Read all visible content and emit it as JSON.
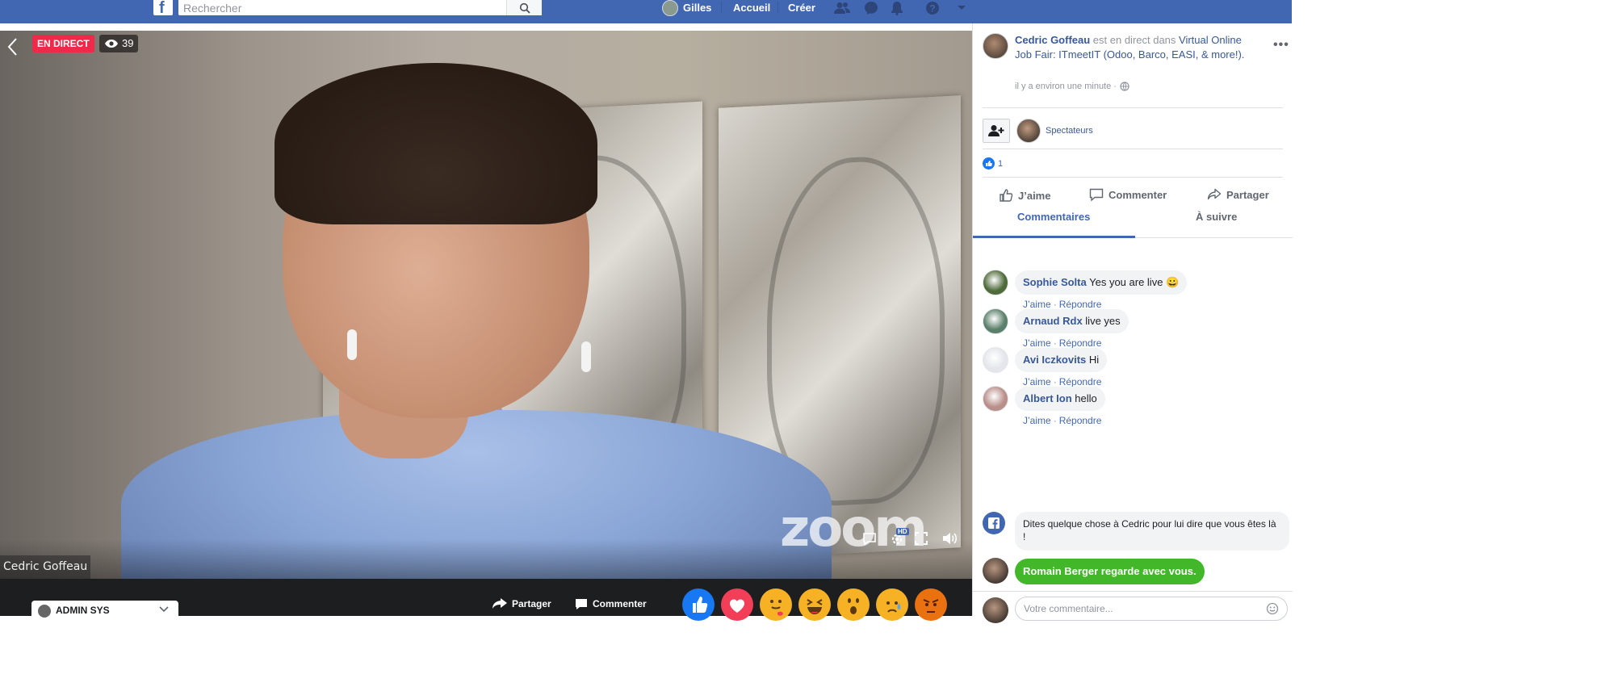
{
  "topbar": {
    "logo_letter": "f",
    "search_placeholder": "Rechercher",
    "user_name": "Gilles",
    "nav_home": "Accueil",
    "nav_create": "Créer"
  },
  "video": {
    "live_badge": "EN DIRECT",
    "viewer_count": "39",
    "participant_name": "Cedric Goffeau",
    "watermark": "zoom",
    "hd_label": "HD"
  },
  "bottombar": {
    "post_as": "ADMIN SYS",
    "share": "Partager",
    "comment": "Commenter"
  },
  "post": {
    "author": "Cedric Goffeau",
    "live_text": " est en direct dans ",
    "group": "Virtual Online Job Fair: ITmeetIT (Odoo, Barco, EASI, & more!).",
    "time": "il y a environ une minute ·",
    "spectators": "Spectateurs",
    "like_count": "1",
    "action_like": "J’aime",
    "action_comment": "Commenter",
    "action_share": "Partager",
    "tab_comments": "Commentaires",
    "tab_follow": "À suivre"
  },
  "comments": [
    {
      "author": "Sophie Solta",
      "text": "Yes you are live 😀",
      "like": "J’aime",
      "sep": "·",
      "reply": "Répondre",
      "avatar_color": "#4f6b3a"
    },
    {
      "author": "Arnaud Rdx",
      "text": "live yes",
      "like": "J’aime",
      "sep": "·",
      "reply": "Répondre",
      "avatar_color": "#5a7f6a"
    },
    {
      "author": "Avi Iczkovits",
      "text": "Hi",
      "like": "J’aime",
      "sep": "·",
      "reply": "Répondre",
      "avatar_color": "#e4e6eb"
    },
    {
      "author": "Albert Ion",
      "text": "hello",
      "like": "J’aime",
      "sep": "·",
      "reply": "Répondre",
      "avatar_color": "#b98f8a"
    }
  ],
  "notice": "Dites quelque chose à Cedric pour lui dire que vous êtes là !",
  "watching": "Romain Berger regarde avec vous.",
  "composer_placeholder": "Votre commentaire...",
  "colors": {
    "fb_blue": "#4267b2",
    "live_red": "#f02849",
    "watch_green": "#42b72a",
    "link_blue": "#385898"
  }
}
